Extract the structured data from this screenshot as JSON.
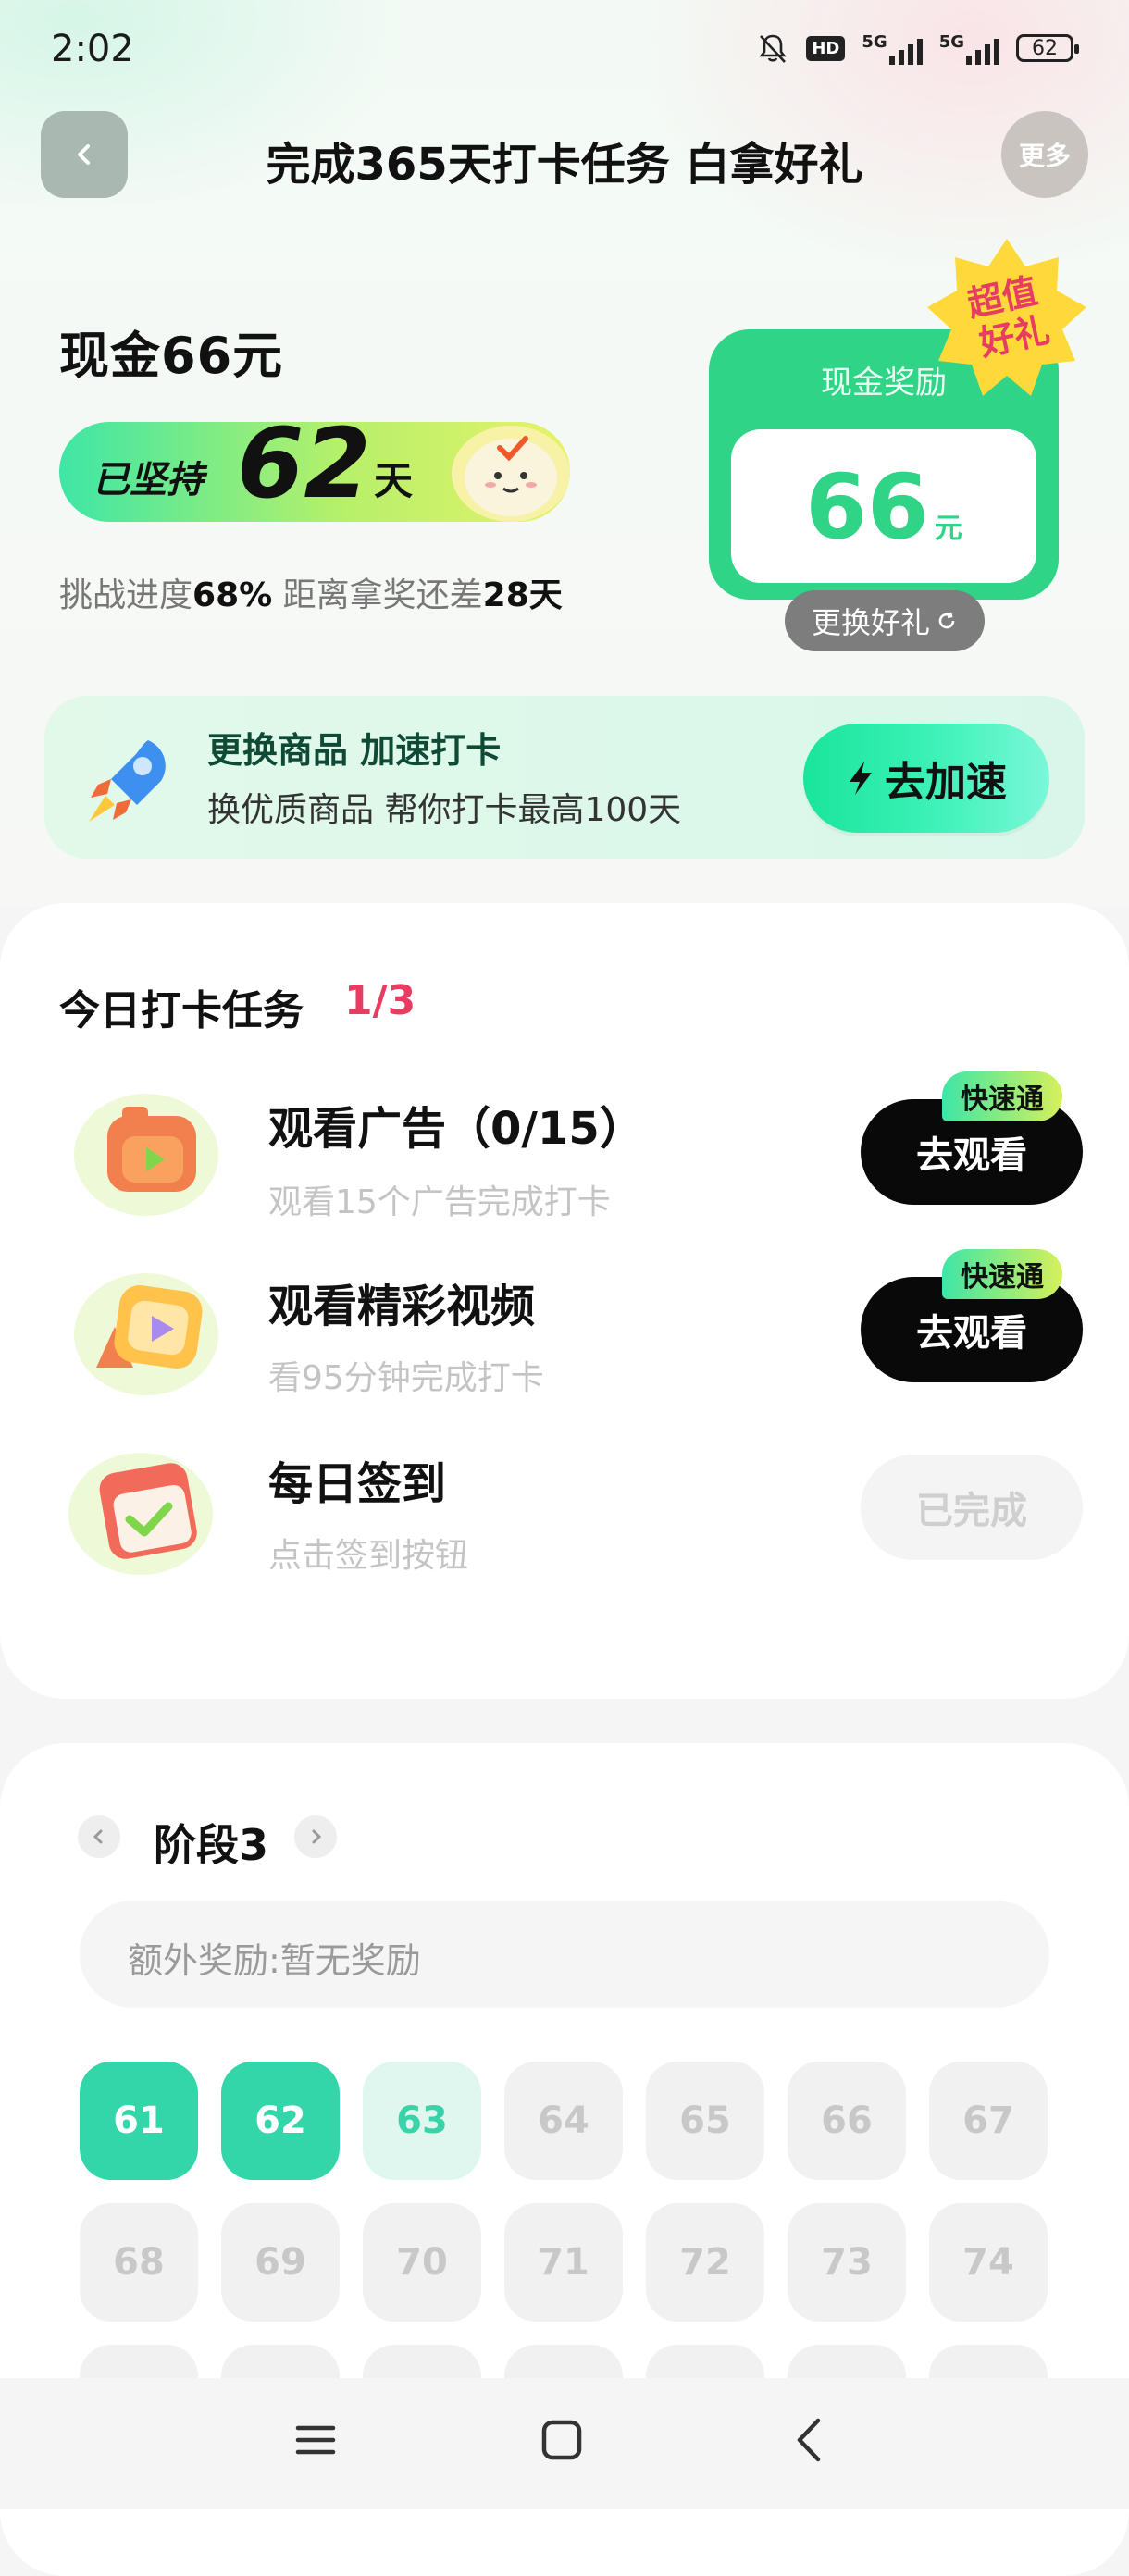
{
  "status": {
    "time": "2:02",
    "battery": "62",
    "network1": "5G",
    "network2": "5G",
    "hd": "HD"
  },
  "header": {
    "title": "完成365天打卡任务 白拿好礼",
    "more": "更多"
  },
  "hero": {
    "cash_title": "现金66元",
    "persist_prefix": "已坚持",
    "persist_days": "62",
    "persist_unit": "天",
    "progress_prefix": "挑战进度",
    "progress_pct": "68%",
    "progress_mid": " 距离拿奖还差",
    "remaining": "28天",
    "reward_label": "现金奖励",
    "reward_value": "66",
    "reward_unit": "元",
    "change_gift": "更换好礼",
    "badge_line1": "超值",
    "badge_line2": "好礼"
  },
  "boost": {
    "title": "更换商品 加速打卡",
    "subtitle": "换优质商品 帮你打卡最高100天",
    "button": "去加速"
  },
  "tasks": {
    "title": "今日打卡任务",
    "count": "1/3",
    "items": [
      {
        "title": "观看广告（0/15）",
        "subtitle": "观看15个广告完成打卡",
        "button": "去观看",
        "tag": "快速通"
      },
      {
        "title": "观看精彩视频",
        "subtitle": "看95分钟完成打卡",
        "button": "去观看",
        "tag": "快速通"
      },
      {
        "title": "每日签到",
        "subtitle": "点击签到按钮",
        "button": "已完成"
      }
    ]
  },
  "stage": {
    "title": "阶段3",
    "bonus": "额外奖励:暂无奖励",
    "days": [
      "61",
      "62",
      "63",
      "64",
      "65",
      "66",
      "67",
      "68",
      "69",
      "70",
      "71",
      "72",
      "73",
      "74"
    ],
    "completed_through": 62,
    "today": 63
  },
  "colors": {
    "accent": "#2fd487",
    "pink": "#e83d63",
    "teal": "#33d6a8"
  }
}
